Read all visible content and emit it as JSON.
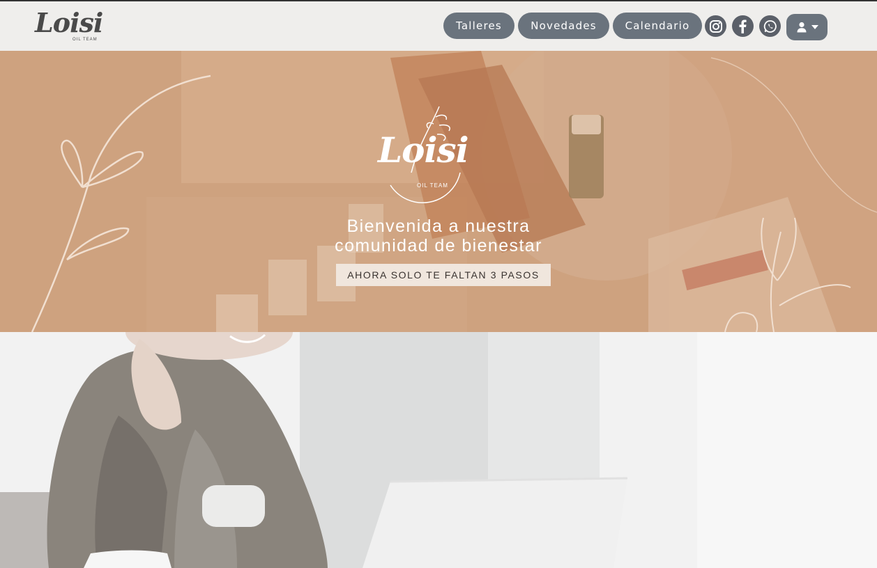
{
  "brand": {
    "name": "Loisi",
    "subtitle": "OIL TEAM"
  },
  "nav": {
    "items": [
      {
        "label": "Talleres"
      },
      {
        "label": "Novedades"
      },
      {
        "label": "Calendario"
      }
    ],
    "social": [
      "instagram-icon",
      "facebook-icon",
      "whatsapp-icon"
    ],
    "user_menu_icon": "user-icon"
  },
  "hero": {
    "logo_name": "Loisi",
    "logo_subtitle": "OIL TEAM",
    "title_line1": "Bienvenida a nuestra",
    "title_line2": "comunidad de bienestar",
    "cta_label": "AHORA SOLO TE FALTAN 3 PASOS"
  },
  "colors": {
    "navbar_bg": "#efeeec",
    "nav_button": "#6a737d",
    "hero_tint": "#c9a183",
    "cta_bg": "#f0e6dd"
  }
}
